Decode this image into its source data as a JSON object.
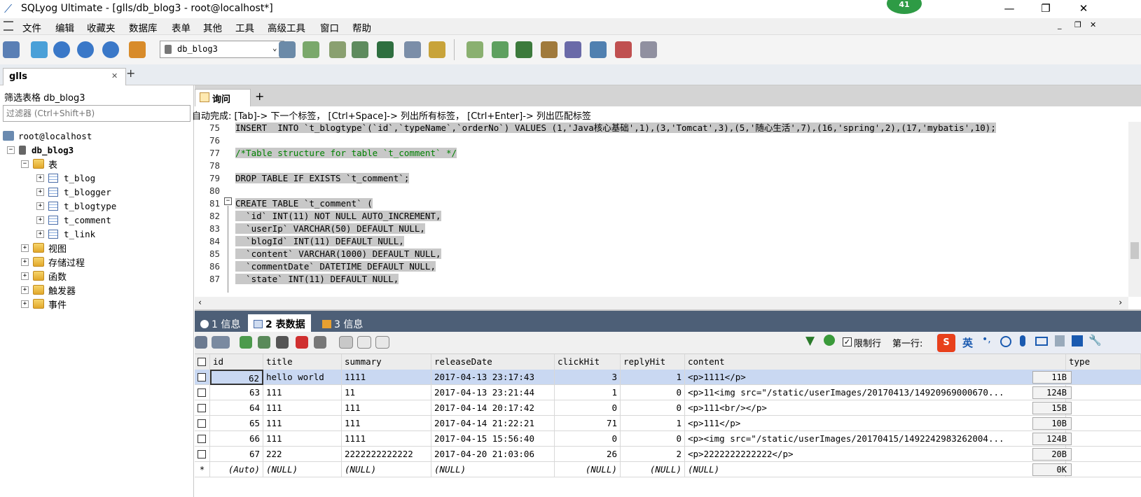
{
  "window": {
    "title": "SQLyog Ultimate - [glls/db_blog3 - root@localhost*]",
    "badge": "41",
    "minimize": "—",
    "restore": "❐",
    "close": "✕"
  },
  "menu": [
    "文件",
    "编辑",
    "收藏夹",
    "数据库",
    "表单",
    "其他",
    "工具",
    "高级工具",
    "窗口",
    "帮助"
  ],
  "toolbar": {
    "db_select": "db_blog3"
  },
  "conn_tab": {
    "label": "glls",
    "close": "✕",
    "add": "+"
  },
  "left": {
    "filter_title": "筛选表格 db_blog3",
    "filter_placeholder": "过滤器 (Ctrl+Shift+B)",
    "root": "root@localhost",
    "db": "db_blog3",
    "tables_folder": "表",
    "tables": [
      "t_blog",
      "t_blogger",
      "t_blogtype",
      "t_comment",
      "t_link"
    ],
    "folders": [
      "视图",
      "存储过程",
      "函数",
      "触发器",
      "事件"
    ]
  },
  "query": {
    "tab": "询问",
    "autocomplete": "自动完成:  [Tab]-> 下一个标签，  [Ctrl+Space]-> 列出所有标签，  [Ctrl+Enter]-> 列出匹配标签",
    "line_numbers": [
      "75",
      "76",
      "77",
      "78",
      "79",
      "80",
      "81",
      "82",
      "83",
      "84",
      "85",
      "86",
      "87"
    ],
    "lines": [
      "INSERT  INTO `t_blogtype`(`id`,`typeName`,`orderNo`) VALUES (1,'Java核心基础',1),(3,'Tomcat',3),(5,'随心生活',7),(16,'spring',2),(17,'mybatis',10);",
      "",
      "/*Table structure for table `t_comment` */",
      "",
      "DROP TABLE IF EXISTS `t_comment`;",
      "",
      "CREATE TABLE `t_comment` (",
      "  `id` INT(11) NOT NULL AUTO_INCREMENT,",
      "  `userIp` VARCHAR(50) DEFAULT NULL,",
      "  `blogId` INT(11) DEFAULT NULL,",
      "  `content` VARCHAR(1000) DEFAULT NULL,",
      "  `commentDate` DATETIME DEFAULT NULL,",
      "  `state` INT(11) DEFAULT NULL,"
    ]
  },
  "result_tabs": [
    "1 信息",
    "2 表数据",
    "3 信息"
  ],
  "result_toolbar": {
    "limit_label": "限制行",
    "first_row_label": "第一行:",
    "ime": "英"
  },
  "grid": {
    "columns": [
      "id",
      "title",
      "summary",
      "releaseDate",
      "clickHit",
      "replyHit",
      "content",
      "type"
    ],
    "rows": [
      [
        "62",
        "hello world",
        "1111",
        "2017-04-13 23:17:43",
        "3",
        "1",
        "<p>1111</p>",
        "11B"
      ],
      [
        "63",
        "111",
        "11",
        "2017-04-13 23:21:44",
        "1",
        "0",
        "<p>11<img src=\"/static/userImages/20170413/14920969000670...",
        "124B"
      ],
      [
        "64",
        "111",
        "111",
        "2017-04-14 20:17:42",
        "0",
        "0",
        "<p>111<br/></p>",
        "15B"
      ],
      [
        "65",
        "111",
        "111",
        "2017-04-14 21:22:21",
        "71",
        "1",
        "<p>111</p>",
        "10B"
      ],
      [
        "66",
        "111",
        "1111",
        "2017-04-15 15:56:40",
        "0",
        "0",
        "<p><img src=\"/static/userImages/20170415/1492242983262004...",
        "124B"
      ],
      [
        "67",
        "222",
        "2222222222222",
        "2017-04-20 21:03:06",
        "26",
        "2",
        "<p>2222222222222</p>",
        "20B"
      ]
    ],
    "new_row": [
      "*",
      "(Auto)",
      "(NULL)",
      "(NULL)",
      "(NULL)",
      "(NULL)",
      "(NULL)",
      "(NULL)",
      "0K"
    ]
  }
}
